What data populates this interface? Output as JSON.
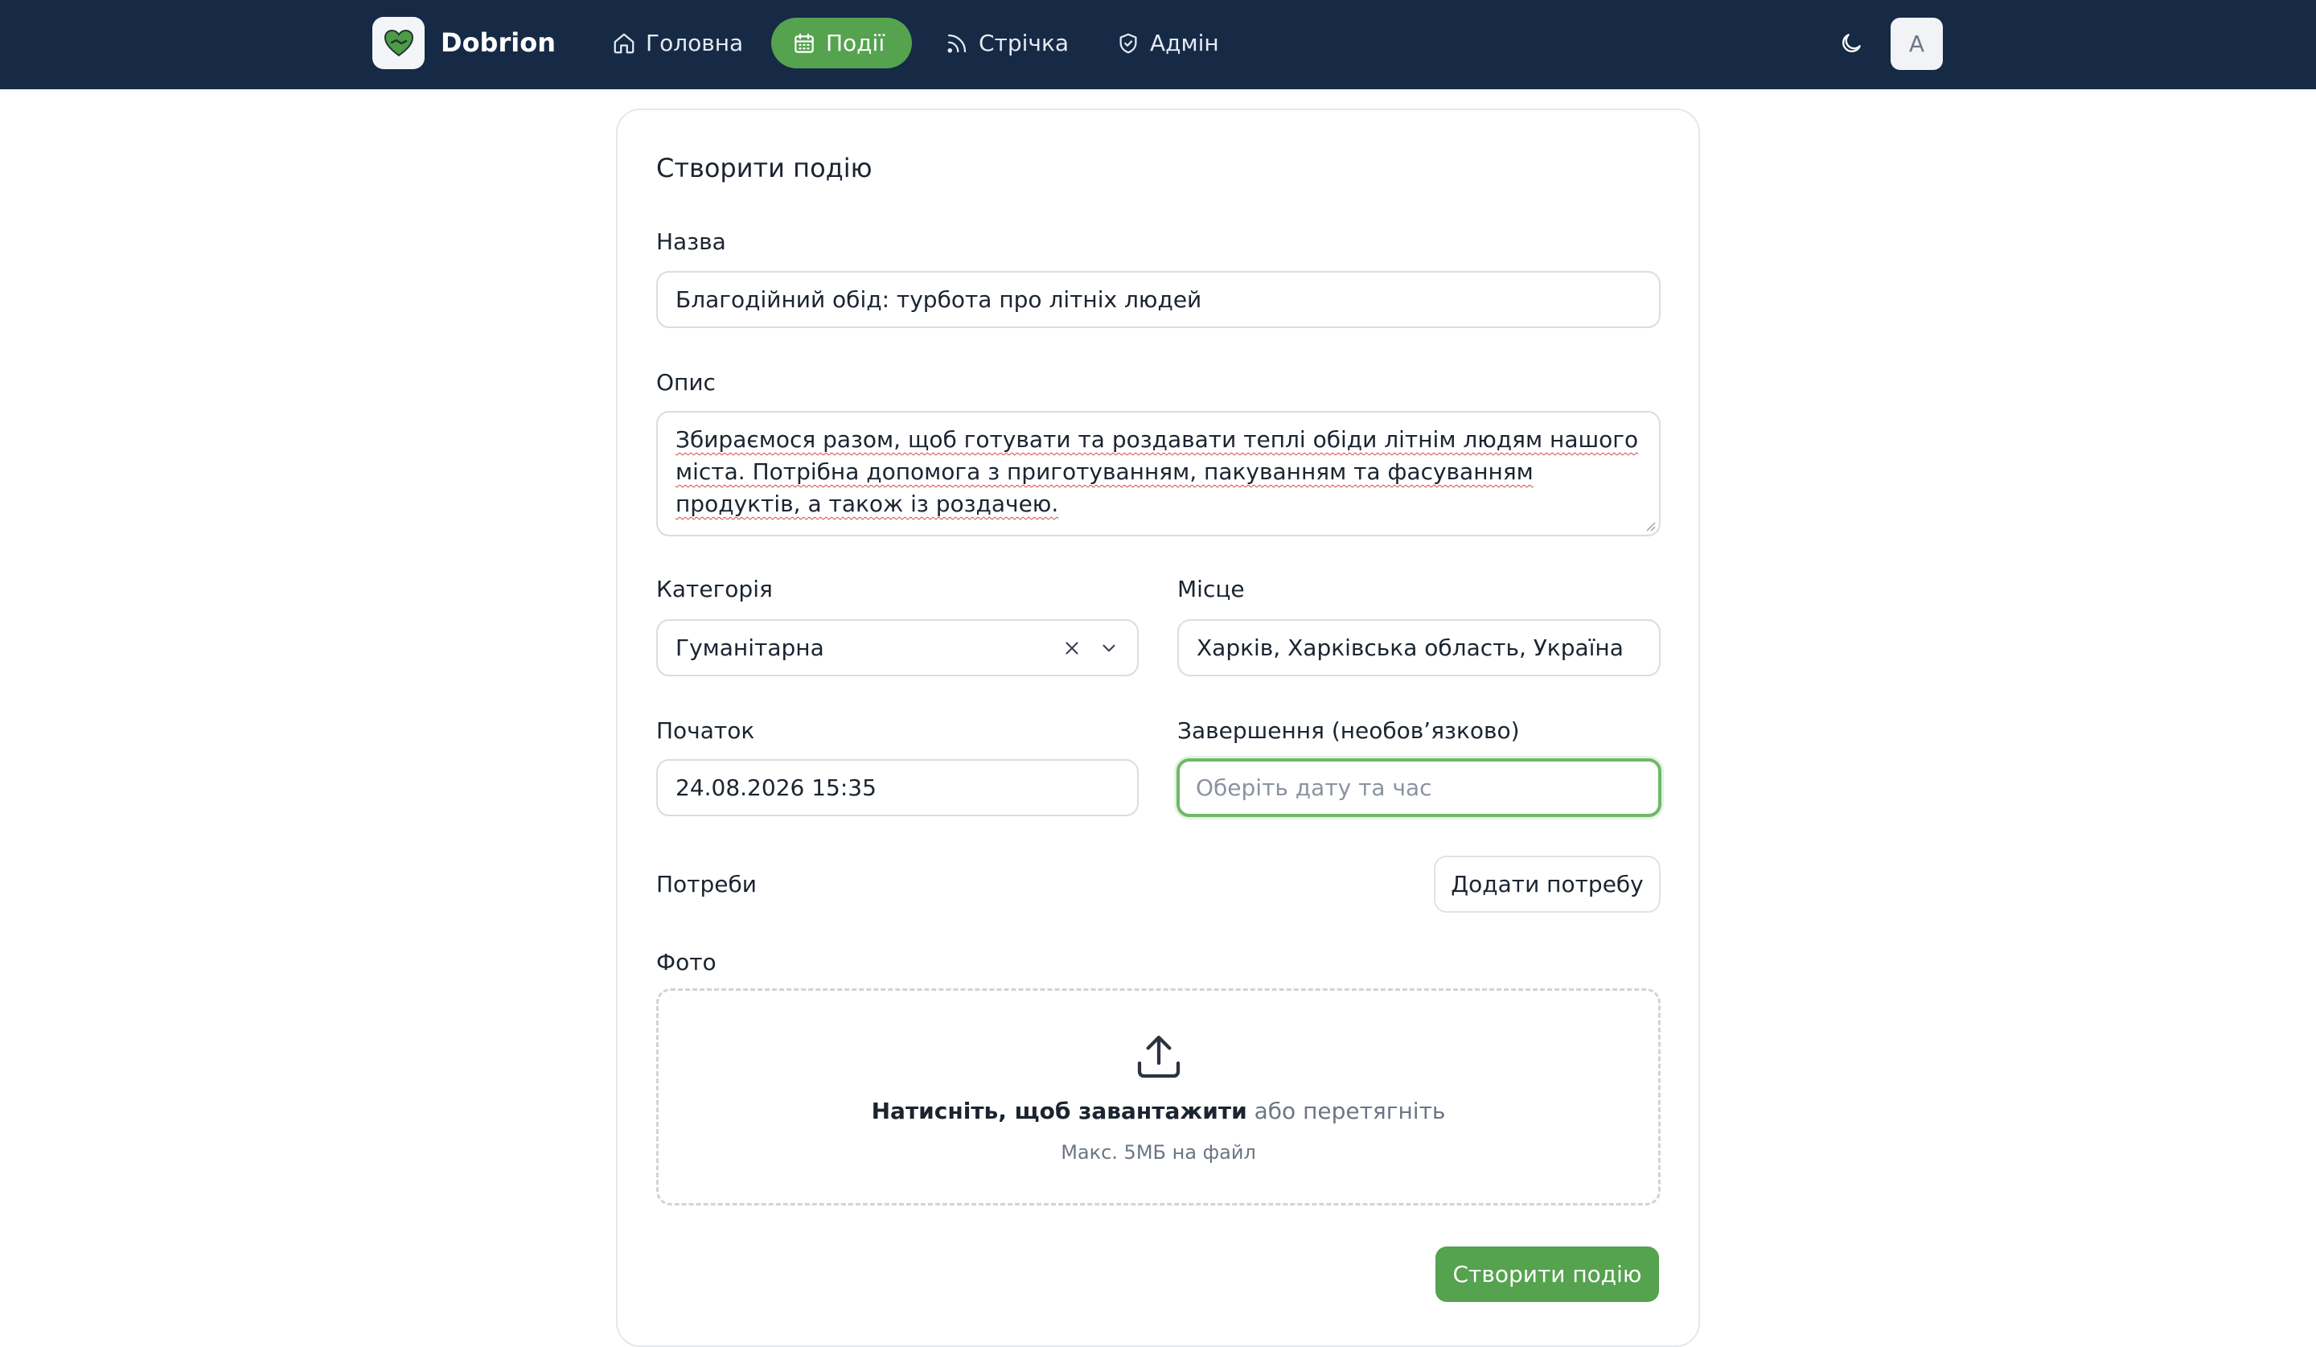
{
  "nav": {
    "brand": "Dobrion",
    "items": [
      {
        "label": "Головна",
        "icon": "home-icon"
      },
      {
        "label": "Події",
        "icon": "calendar-icon",
        "active": true
      },
      {
        "label": "Стрічка",
        "icon": "rss-icon"
      },
      {
        "label": "Адмін",
        "icon": "shield-icon"
      }
    ],
    "theme_icon": "moon-icon",
    "avatar": "A"
  },
  "form": {
    "title": "Створити подію",
    "name_label": "Назва",
    "name_value": "Благодійний обід: турбота про літніх людей",
    "description_label": "Опис",
    "description_value": "Збираємося разом, щоб готувати та роздавати теплі обіди літнім людям нашого міста. Потрібна допомога з приготуванням, пакуванням та фасуванням продуктів, а також із роздачею.",
    "category_label": "Категорія",
    "category_value": "Гуманітарна",
    "place_label": "Місце",
    "place_value": "Харків, Харківська область, Україна",
    "start_label": "Початок",
    "start_value": "24.08.2026 15:35",
    "end_label": "Завершення (необов’язково)",
    "end_placeholder": "Оберіть дату та час",
    "needs_label": "Потреби",
    "add_need_button": "Додати потребу",
    "photo_label": "Фото",
    "upload_strong": "Натисніть, щоб завантажити",
    "upload_rest": "або перетягніть",
    "upload_hint": "Макс. 5МБ на файл",
    "submit_button": "Створити подію"
  },
  "colors": {
    "nav_bg": "#162a46",
    "accent": "#55a24f",
    "focus_border": "#6fb869"
  }
}
